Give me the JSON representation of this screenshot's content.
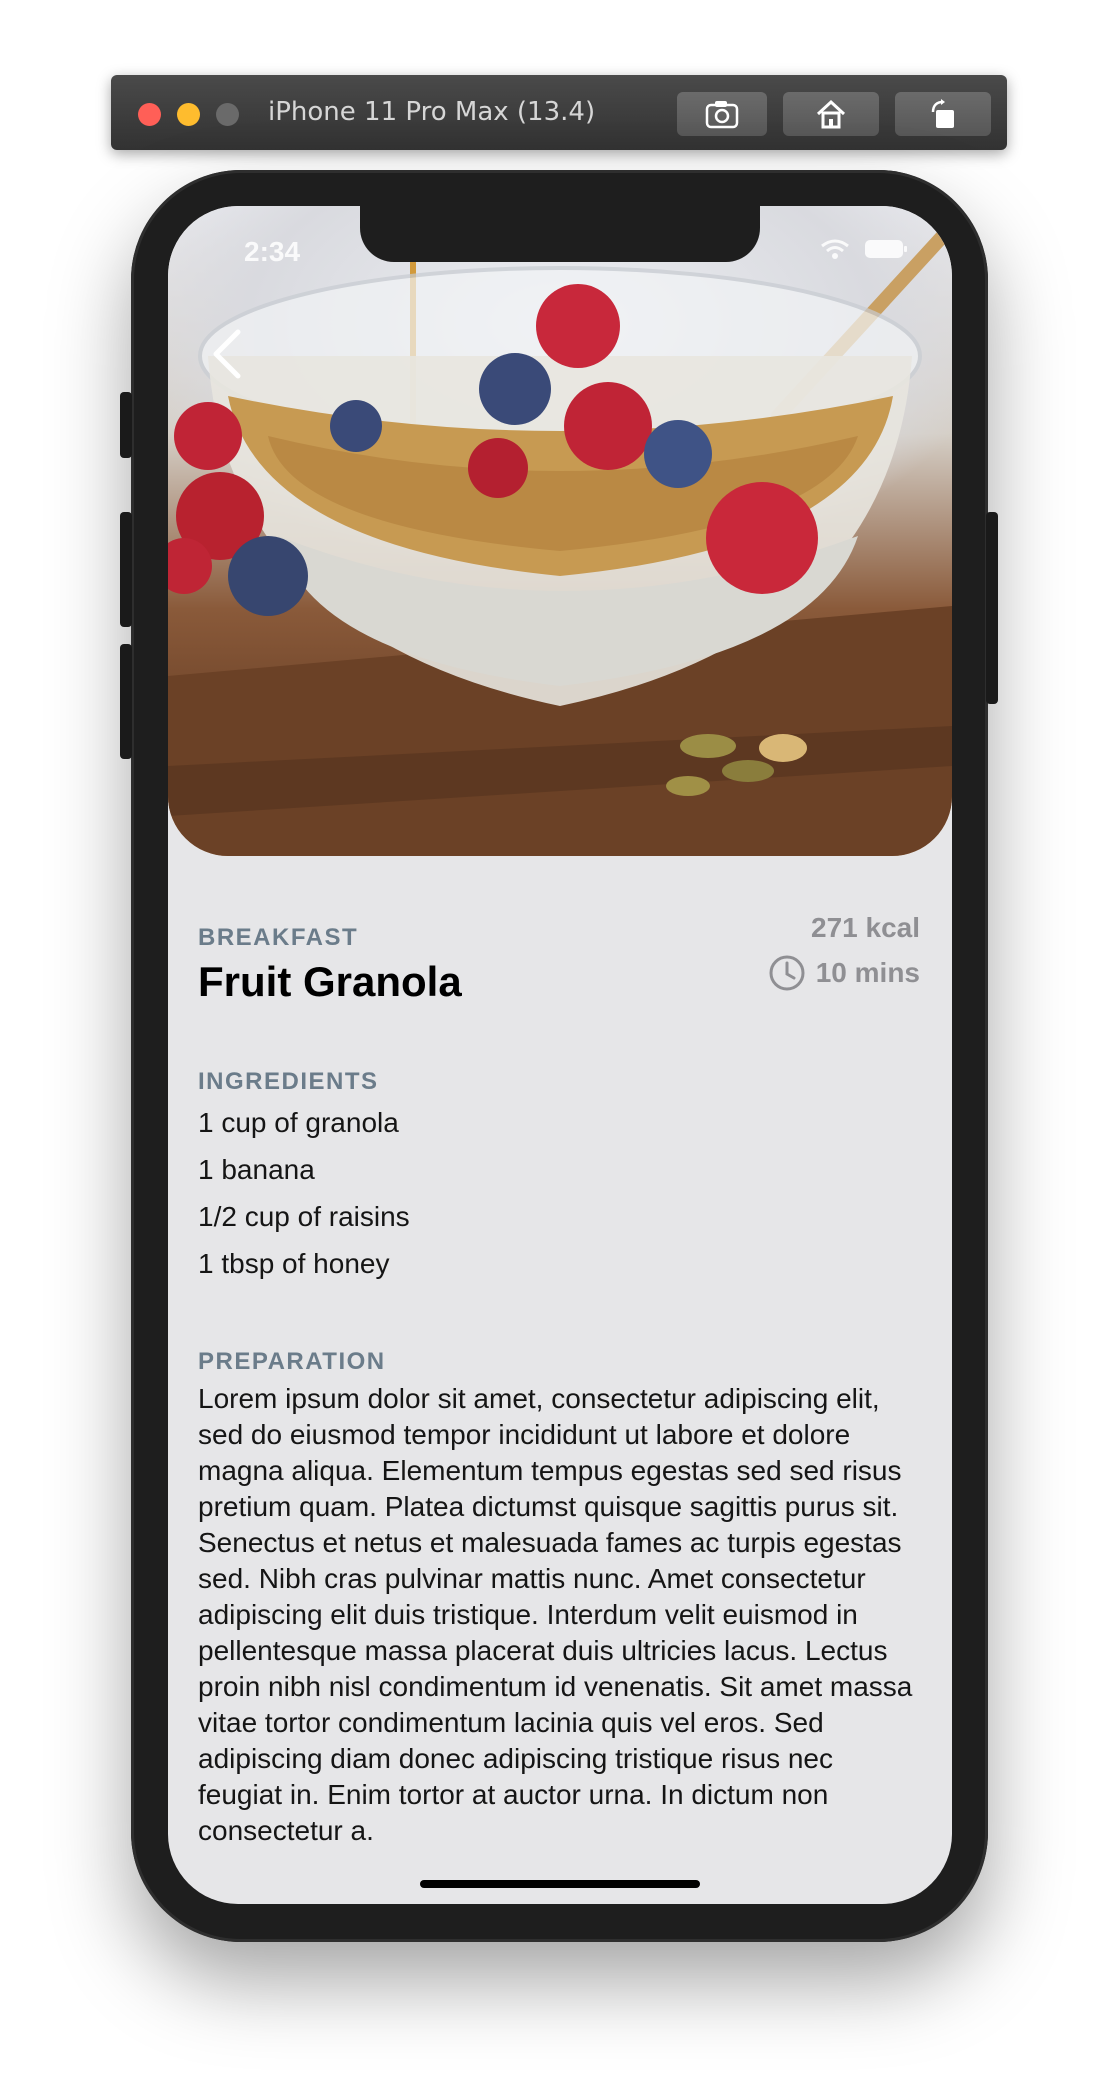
{
  "simulator": {
    "title": "iPhone 11 Pro Max (13.4)",
    "buttons": {
      "screenshot": "camera-icon",
      "home": "home-icon",
      "rotate": "rotate-icon"
    }
  },
  "status_bar": {
    "time": "2:34"
  },
  "recipe": {
    "category": "BREAKFAST",
    "title": "Fruit Granola",
    "calories": "271 kcal",
    "duration": "10 mins",
    "ingredients_label": "INGREDIENTS",
    "ingredients": [
      "1 cup of granola",
      "1 banana",
      "1/2 cup of raisins",
      "1 tbsp of honey"
    ],
    "preparation_label": "PREPARATION",
    "preparation": "Lorem ipsum dolor sit amet, consectetur adipiscing elit, sed do eiusmod tempor incididunt ut labore et dolore magna aliqua. Elementum tempus egestas sed sed risus pretium quam. Platea dictumst quisque sagittis purus sit. Senectus et netus et malesuada fames ac turpis egestas sed. Nibh cras pulvinar mattis nunc. Amet consectetur adipiscing elit duis tristique. Interdum velit euismod in pellentesque massa placerat duis ultricies lacus. Lectus proin nibh nisl condimentum id venenatis. Sit amet massa vitae tortor condimentum lacinia quis vel eros. Sed adipiscing diam donec adipiscing tristique risus nec feugiat in. Enim tortor at auctor urna. In dictum non consectetur a."
  },
  "colors": {
    "section_label": "#6b7c8a",
    "meta_text": "#8f8f93",
    "screen_background": "#e6e6e8"
  }
}
